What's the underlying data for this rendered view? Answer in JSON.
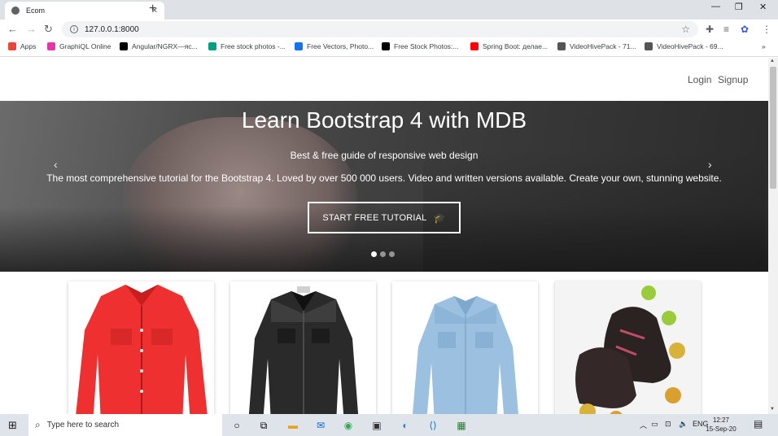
{
  "browser": {
    "tab_title": "Ecom",
    "tab_close": "✕",
    "new_tab": "+",
    "window_controls": {
      "minimize": "—",
      "restore": "❐",
      "close": "✕"
    },
    "url": "127.0.0.1:8000",
    "bookmarks": [
      {
        "label": "Apps",
        "icon": "apps-grid-icon",
        "color": "#e8453c"
      },
      {
        "label": "GraphiQL Online",
        "icon": "graphiql-icon",
        "color": "#e535ab"
      },
      {
        "label": "Angular/NGRX—яс...",
        "icon": "medium-icon",
        "color": "#000000"
      },
      {
        "label": "Free stock photos -...",
        "icon": "pexels-icon",
        "color": "#05a081"
      },
      {
        "label": "Free Vectors, Photo...",
        "icon": "freepik-icon",
        "color": "#1273eb"
      },
      {
        "label": "Free Stock Photos:...",
        "icon": "burst-icon",
        "color": "#000000"
      },
      {
        "label": "Spring Boot: делае...",
        "icon": "youtube-icon",
        "color": "#ff0000"
      },
      {
        "label": "VideoHivePack - 71...",
        "icon": "videohive-icon",
        "color": "#555555"
      },
      {
        "label": "VideoHivePack - 69...",
        "icon": "videohive-icon",
        "color": "#555555"
      }
    ],
    "bookmarks_more": "»"
  },
  "site": {
    "nav": {
      "login": "Login",
      "signup": "Signup"
    },
    "hero": {
      "title": "Learn Bootstrap 4 with MDB",
      "subtitle": "Best & free guide of responsive web design",
      "description": "The most comprehensive tutorial for the Bootstrap 4. Loved by over 500 000 users. Video and written versions available. Create your own, stunning website.",
      "cta": "START FREE TUTORIAL",
      "prev": "‹",
      "next": "›",
      "slides": 3,
      "active_slide": 1
    },
    "products": [
      {
        "name": "red-denim-jacket",
        "color": "#ee3b3b"
      },
      {
        "name": "black-denim-shirt",
        "color": "#2a2a2a"
      },
      {
        "name": "light-blue-denim-shirt",
        "color": "#9ec2e0"
      },
      {
        "name": "inline-skates",
        "color": "#3a2a2a"
      }
    ]
  },
  "taskbar": {
    "start": "⊞",
    "search_placeholder": "Type here to search",
    "language": "ENG",
    "time": "12:27",
    "date": "15-Sep-20"
  }
}
